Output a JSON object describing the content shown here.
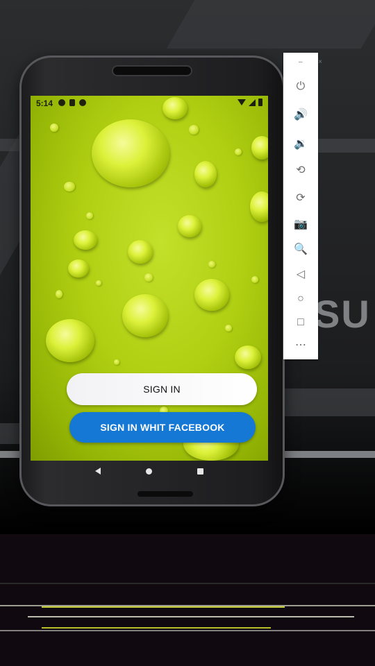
{
  "device": {
    "status_bar": {
      "time": "5:14"
    },
    "buttons": {
      "sign_in": "SIGN IN",
      "sign_in_facebook": "SIGN IN WHIT FACEBOOK"
    },
    "colors": {
      "facebook_blue": "#1478d4",
      "wallpaper_green": "#b0cf12"
    },
    "nav_icons": [
      "back-icon",
      "home-icon",
      "recent-apps-icon"
    ]
  },
  "emulator_toolbar": {
    "window_controls": {
      "minimize": "–",
      "close": "×"
    },
    "tools": [
      {
        "name": "power-icon",
        "glyph": "⏻"
      },
      {
        "name": "volume-up-icon",
        "glyph": "🔊"
      },
      {
        "name": "volume-down-icon",
        "glyph": "🔉"
      },
      {
        "name": "rotate-left-icon",
        "glyph": "⟲"
      },
      {
        "name": "rotate-right-icon",
        "glyph": "⟳"
      },
      {
        "name": "screenshot-icon",
        "glyph": "📷"
      },
      {
        "name": "zoom-icon",
        "glyph": "🔍"
      },
      {
        "name": "back-icon",
        "glyph": "◁"
      },
      {
        "name": "home-icon",
        "glyph": "○"
      },
      {
        "name": "overview-icon",
        "glyph": "□"
      },
      {
        "name": "more-icon",
        "glyph": "⋯"
      }
    ]
  },
  "background": {
    "monitor_brand_text": "SU"
  }
}
